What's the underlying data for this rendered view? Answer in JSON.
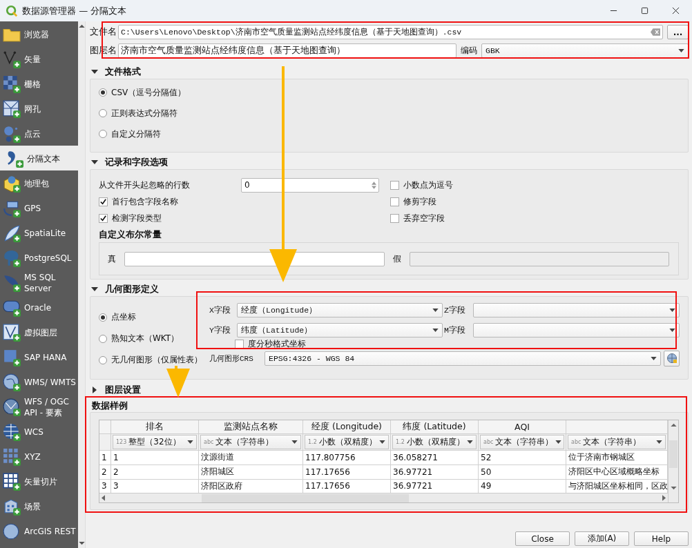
{
  "window": {
    "title": "数据源管理器 — 分隔文本"
  },
  "sidebar": {
    "items": [
      {
        "label": "浏览器",
        "selected": false
      },
      {
        "label": "矢量",
        "selected": false
      },
      {
        "label": "栅格",
        "selected": false
      },
      {
        "label": "网孔",
        "selected": false
      },
      {
        "label": "点云",
        "selected": false
      },
      {
        "label": "分隔文本",
        "selected": true
      },
      {
        "label": "地理包",
        "selected": false
      },
      {
        "label": "GPS",
        "selected": false
      },
      {
        "label": "SpatiaLite",
        "selected": false
      },
      {
        "label": "PostgreSQL",
        "selected": false
      },
      {
        "label": "MS SQL Server",
        "selected": false
      },
      {
        "label": "Oracle",
        "selected": false
      },
      {
        "label": "虚拟图层",
        "selected": false
      },
      {
        "label": "SAP HANA",
        "selected": false
      },
      {
        "label": "WMS/ WMTS",
        "selected": false
      },
      {
        "label": "WFS / OGC API - 要素",
        "selected": false
      },
      {
        "label": "WCS",
        "selected": false
      },
      {
        "label": "XYZ",
        "selected": false
      },
      {
        "label": "矢量切片",
        "selected": false
      },
      {
        "label": "场景",
        "selected": false
      },
      {
        "label": "ArcGIS REST",
        "selected": false
      }
    ]
  },
  "file": {
    "label": "文件名",
    "value": "C:\\Users\\Lenovo\\Desktop\\济南市空气质量监测站点经纬度信息（基于天地图查询）.csv",
    "browse_button": "..."
  },
  "layer": {
    "label": "图层名",
    "value": "济南市空气质量监测站点经纬度信息（基于天地图查询）"
  },
  "encoding": {
    "label": "编码",
    "value": "GBK"
  },
  "file_format": {
    "title": "文件格式",
    "expanded": true,
    "options": [
      {
        "label": "CSV（逗号分隔值）",
        "selected": true
      },
      {
        "label": "正则表达式分隔符",
        "selected": false
      },
      {
        "label": "自定义分隔符",
        "selected": false
      }
    ]
  },
  "records": {
    "title": "记录和字段选项",
    "expanded": true,
    "skip_label": "从文件开头起忽略的行数",
    "skip_value": "0",
    "checks": [
      {
        "label": "小数点为逗号",
        "checked": false
      },
      {
        "label": "首行包含字段名称",
        "checked": true
      },
      {
        "label": "修剪字段",
        "checked": false
      },
      {
        "label": "检测字段类型",
        "checked": true
      },
      {
        "label": "丢弃空字段",
        "checked": false
      }
    ],
    "bool_title": "自定义布尔常量",
    "bool_fields": [
      {
        "label": "真",
        "disabled": false
      },
      {
        "label": "假",
        "disabled": true
      }
    ]
  },
  "geometry": {
    "title": "几何图形定义",
    "expanded": true,
    "options": [
      {
        "label": "点坐标",
        "selected": true
      },
      {
        "label": "熟知文本（WKT）",
        "selected": false
      },
      {
        "label": "无几何图形（仅属性表）",
        "selected": false
      }
    ],
    "fields": [
      {
        "label": "X字段",
        "value": "经度（Longitude）"
      },
      {
        "label": "Z字段"
      },
      {
        "label": "Y字段",
        "value": "纬度（Latitude）"
      },
      {
        "label": "M字段"
      }
    ],
    "dms": {
      "label": "度分秒格式坐标",
      "checked": false
    },
    "crs": {
      "label": "几何图形CRS",
      "value": "EPSG:4326 - WGS 84"
    }
  },
  "layer_settings": {
    "title": "图层设置",
    "expanded": false
  },
  "sample": {
    "title": "数据样例",
    "columns": [
      {
        "header": "排名",
        "type_icon": "123",
        "type": "整型（32位）"
      },
      {
        "header": "监测站点名称",
        "type_icon": "abc",
        "type": "文本（字符串）"
      },
      {
        "header": "经度 (Longitude)",
        "type_icon": "1.2",
        "type": "小数（双精度）"
      },
      {
        "header": "纬度 (Latitude)",
        "type_icon": "1.2",
        "type": "小数（双精度）"
      },
      {
        "header": "AQI",
        "type_icon": "abc",
        "type": "文本（字符串）"
      },
      {
        "type_icon": "abc",
        "type": "文本（字符串）"
      }
    ],
    "rows": [
      {
        "num": "1",
        "cells": [
          "1",
          "汶源街道",
          "117.807756",
          "36.058271",
          "52",
          "位于济南市钢城区"
        ]
      },
      {
        "num": "2",
        "cells": [
          "2",
          "济阳城区",
          "117.17656",
          "36.97721",
          "50",
          "济阳区中心区域概略坐标"
        ]
      },
      {
        "num": "3",
        "cells": [
          "3",
          "济阳区政府",
          "117.17656",
          "36.97721",
          "49",
          "与济阳城区坐标相同，区政"
        ]
      }
    ]
  },
  "buttons": [
    {
      "label": "Close"
    },
    {
      "label": "添加(A)"
    },
    {
      "label": "Help"
    }
  ]
}
